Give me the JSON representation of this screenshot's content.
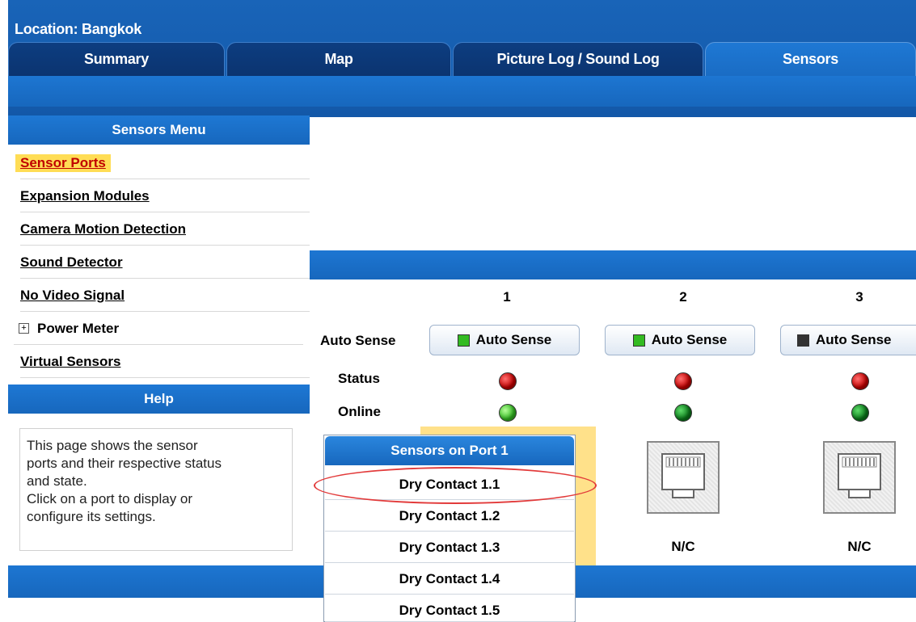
{
  "header": {
    "location": "Location: Bangkok",
    "tabs": [
      {
        "label": "Summary",
        "active": false
      },
      {
        "label": "Map",
        "active": false
      },
      {
        "label": "Picture Log / Sound Log",
        "active": false
      },
      {
        "label": "Sensors",
        "active": true
      }
    ]
  },
  "sidebar": {
    "title": "Sensors Menu",
    "items": [
      {
        "label": "Sensor Ports",
        "active": true
      },
      {
        "label": "Expansion Modules"
      },
      {
        "label": "Camera Motion Detection"
      },
      {
        "label": "Sound Detector"
      },
      {
        "label": "No Video Signal"
      },
      {
        "label": "Power Meter",
        "expandable": true
      },
      {
        "label": "Virtual Sensors"
      }
    ],
    "plus_symbol": "+",
    "help_title": "Help",
    "help_lines": [
      "This page shows the sensor",
      "ports and their respective status",
      "and state.",
      "Click on a port to display or",
      "configure its settings."
    ]
  },
  "ports": {
    "auto_sense_label": "Auto Sense",
    "status_label": "Status",
    "online_label": "Online",
    "columns": [
      {
        "number": "1",
        "auto_sense": "Auto Sense",
        "led": "#33bb22",
        "status": "red",
        "online": "green-light"
      },
      {
        "number": "2",
        "auto_sense": "Auto Sense",
        "led": "#33bb22",
        "status": "red",
        "online": "green-dark",
        "connection": "N/C"
      },
      {
        "number": "3",
        "auto_sense": "Auto Sense",
        "led": "#333333",
        "status": "red",
        "online": "green-dark",
        "connection": "N/C"
      }
    ]
  },
  "popup": {
    "title": "Sensors on Port 1",
    "items": [
      "Dry Contact 1.1",
      "Dry Contact 1.2",
      "Dry Contact 1.3",
      "Dry Contact 1.4",
      "Dry Contact 1.5"
    ]
  },
  "colors": {
    "header_blue": "#1358a8",
    "tab_dark": "#0b3470",
    "accent_red": "#e23a3a",
    "highlight_yellow": "#ffe18a"
  }
}
